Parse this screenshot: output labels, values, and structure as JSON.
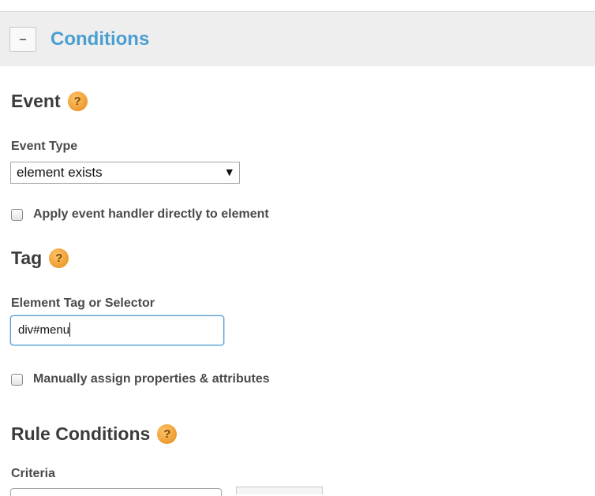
{
  "conditions": {
    "collapse_symbol": "–",
    "title": "Conditions"
  },
  "event": {
    "title": "Event",
    "help_symbol": "?",
    "type_label": "Event Type",
    "type_value": "element exists",
    "type_arrow": "▼",
    "apply_handler_label": "Apply event handler directly to element",
    "apply_handler_checked": false
  },
  "tag": {
    "title": "Tag",
    "help_symbol": "?",
    "selector_label": "Element Tag or Selector",
    "selector_value": "div#menu",
    "manual_assign_label": "Manually assign properties & attributes",
    "manual_assign_checked": false
  },
  "rule_conditions": {
    "title": "Rule Conditions",
    "help_symbol": "?",
    "criteria_label": "Criteria"
  },
  "colors": {
    "header_bg": "#eeeeee",
    "header_title": "#4a9fd0",
    "help_icon": "#f3a33b",
    "input_focus_border": "#5a9fd4"
  },
  "icons": {
    "help": "question-circle-icon",
    "dropdown": "triangle-down-icon",
    "collapse": "minus-icon"
  }
}
